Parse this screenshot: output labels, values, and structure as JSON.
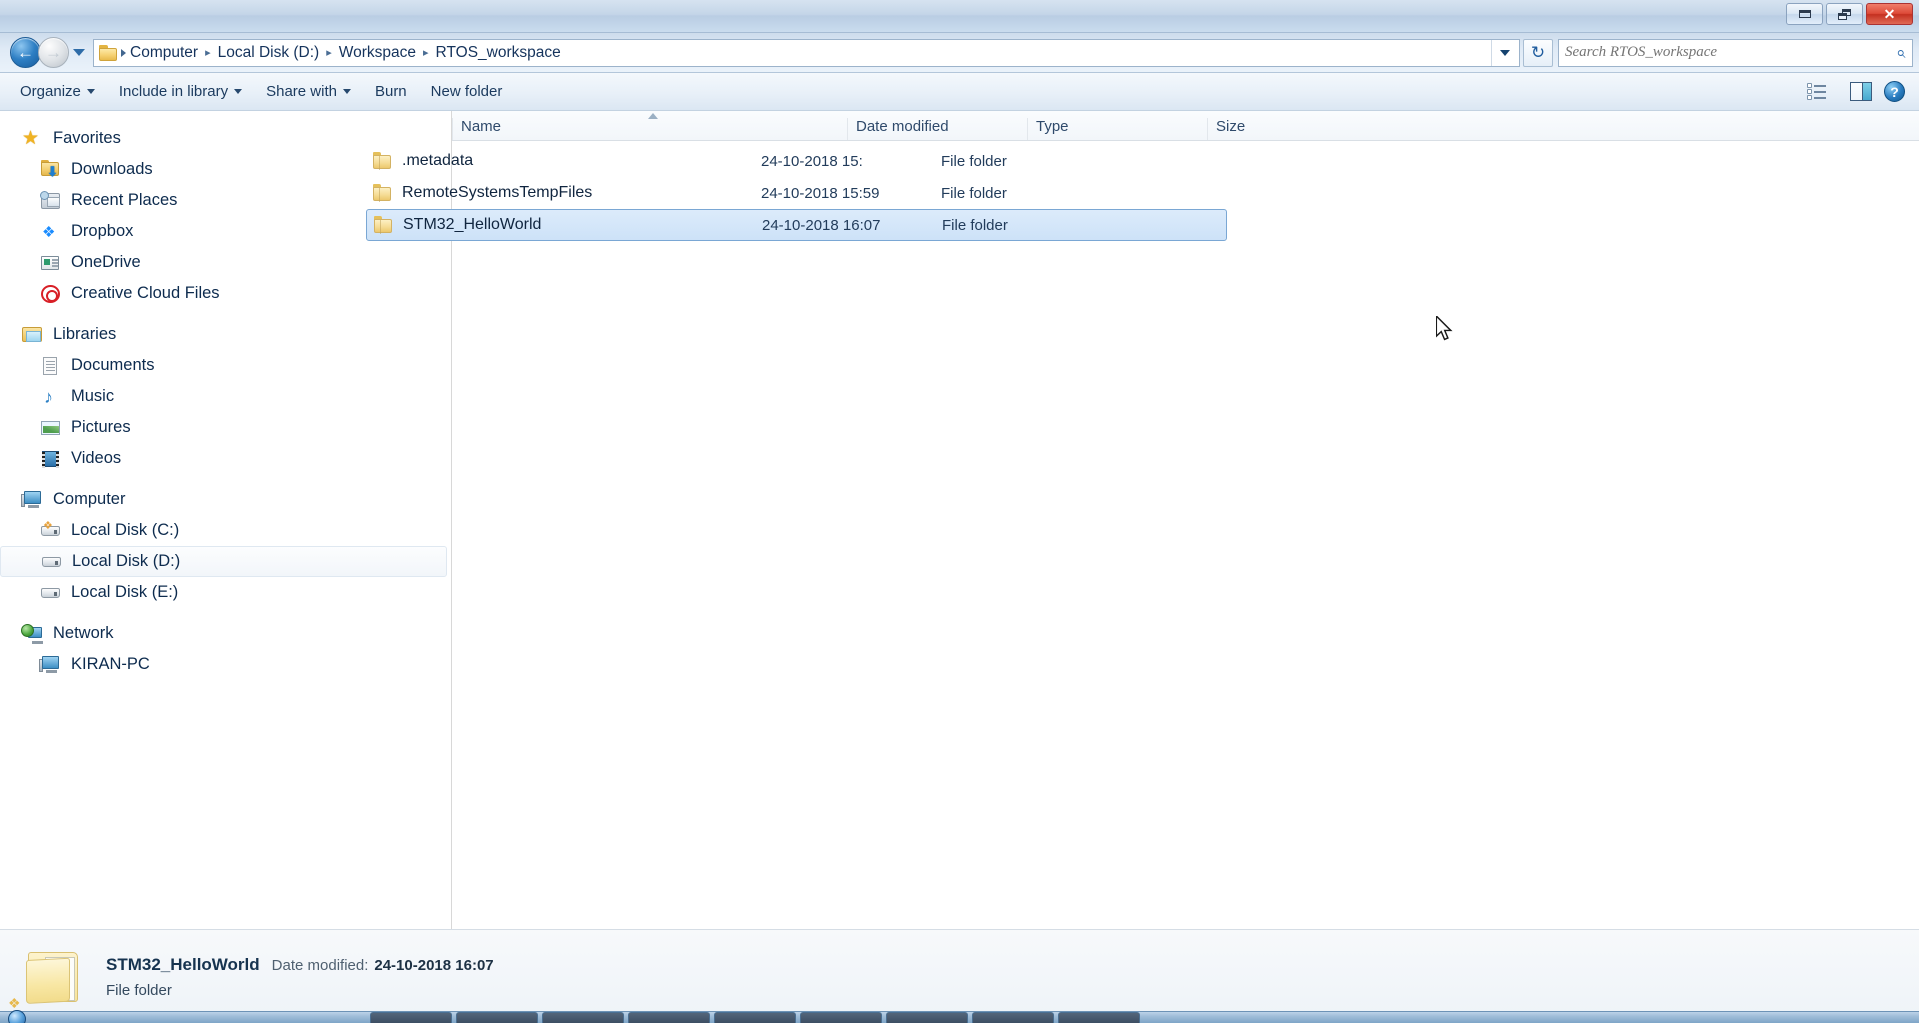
{
  "window": {
    "controls": {
      "minimize_label": "Minimize",
      "restore_label": "Restore",
      "close_label": "Close",
      "close_glyph": "✕"
    }
  },
  "addressbar": {
    "back_label": "Back",
    "back_glyph": "←",
    "forward_label": "Forward",
    "forward_glyph": "→",
    "history_label": "Recent pages",
    "folder_icon": "folder-icon",
    "breadcrumbs": [
      "Computer",
      "Local Disk (D:)",
      "Workspace",
      "RTOS_workspace"
    ],
    "separator": "▸",
    "dropdown_label": "Previous locations",
    "refresh_glyph": "↻",
    "refresh_label": "Refresh"
  },
  "search": {
    "placeholder": "Search RTOS_workspace",
    "value": "",
    "icon": "search-icon",
    "icon_glyph": "⌕"
  },
  "toolbar": {
    "items": [
      {
        "label": "Organize",
        "has_caret": true
      },
      {
        "label": "Include in library",
        "has_caret": true
      },
      {
        "label": "Share with",
        "has_caret": true
      },
      {
        "label": "Burn",
        "has_caret": false
      },
      {
        "label": "New folder",
        "has_caret": false
      }
    ],
    "views_label": "Change your view",
    "views_caret_label": "More options",
    "preview_pane_label": "Show the preview pane",
    "help_label": "Get help",
    "help_glyph": "?"
  },
  "sidebar": {
    "groups": [
      {
        "header": {
          "label": "Favorites",
          "icon": "star-icon"
        },
        "items": [
          {
            "label": "Downloads",
            "icon": "downloads-folder-icon"
          },
          {
            "label": "Recent Places",
            "icon": "recent-places-icon"
          },
          {
            "label": "Dropbox",
            "icon": "dropbox-icon"
          },
          {
            "label": "OneDrive",
            "icon": "onedrive-icon"
          },
          {
            "label": "Creative Cloud Files",
            "icon": "creative-cloud-icon"
          }
        ]
      },
      {
        "header": {
          "label": "Libraries",
          "icon": "libraries-icon"
        },
        "items": [
          {
            "label": "Documents",
            "icon": "documents-icon"
          },
          {
            "label": "Music",
            "icon": "music-icon"
          },
          {
            "label": "Pictures",
            "icon": "pictures-icon"
          },
          {
            "label": "Videos",
            "icon": "videos-icon"
          }
        ]
      },
      {
        "header": {
          "label": "Computer",
          "icon": "computer-icon"
        },
        "items": [
          {
            "label": "Local Disk (C:)",
            "icon": "system-drive-icon",
            "state": "normal"
          },
          {
            "label": "Local Disk (D:)",
            "icon": "drive-icon",
            "state": "hover"
          },
          {
            "label": "Local Disk (E:)",
            "icon": "drive-icon",
            "state": "normal"
          }
        ]
      },
      {
        "header": {
          "label": "Network",
          "icon": "network-icon"
        },
        "items": [
          {
            "label": "KIRAN-PC",
            "icon": "computer-icon"
          }
        ]
      }
    ]
  },
  "filelist": {
    "columns": [
      {
        "label": "Name",
        "sorted": "asc"
      },
      {
        "label": "Date modified",
        "sorted": ""
      },
      {
        "label": "Type",
        "sorted": ""
      },
      {
        "label": "Size",
        "sorted": ""
      }
    ],
    "rows": [
      {
        "name": ".metadata",
        "date_modified": "24-10-2018 15:",
        "type": "File folder",
        "size": "",
        "icon": "folder-icon",
        "selected": false
      },
      {
        "name": "RemoteSystemsTempFiles",
        "date_modified": "24-10-2018 15:59",
        "type": "File folder",
        "size": "",
        "icon": "folder-icon",
        "selected": false
      },
      {
        "name": "STM32_HelloWorld",
        "date_modified": "24-10-2018 16:07",
        "type": "File folder",
        "size": "",
        "icon": "folder-icon",
        "selected": true
      }
    ]
  },
  "statusbar": {
    "item_name": "STM32_HelloWorld",
    "date_modified_label": "Date modified:",
    "date_modified_value": "24-10-2018 16:07",
    "item_type": "File folder",
    "icon": "large-folder-icon"
  },
  "colors": {
    "selection_fill": "#cde2f8",
    "selection_border": "#7aa7d4",
    "chrome_blue": "#b9cde3",
    "folder_yellow": "#f6dd97",
    "accent_text": "#15335c"
  }
}
